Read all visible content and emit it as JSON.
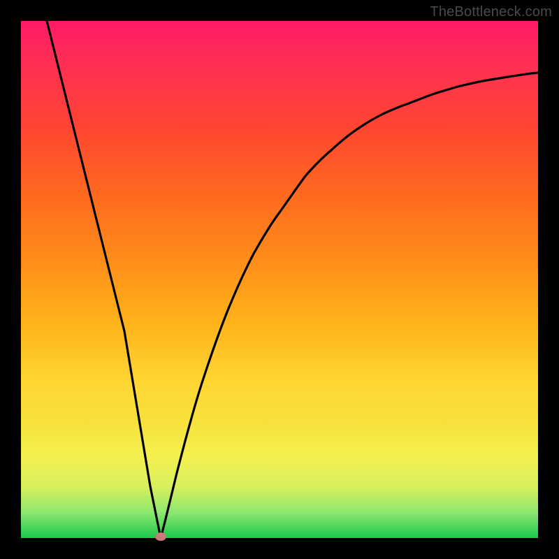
{
  "attribution": "TheBottleneck.com",
  "chart_data": {
    "type": "line",
    "title": "",
    "xlabel": "",
    "ylabel": "",
    "xlim": [
      0,
      100
    ],
    "ylim": [
      0,
      100
    ],
    "grid": false,
    "series": [
      {
        "name": "bottleneck-curve",
        "x": [
          5,
          10,
          15,
          20,
          25,
          27,
          30,
          35,
          40,
          45,
          50,
          55,
          60,
          65,
          70,
          75,
          80,
          85,
          90,
          95,
          100
        ],
        "y": [
          100,
          80,
          60,
          40,
          10,
          0,
          12,
          30,
          44,
          55,
          63,
          70,
          75,
          79,
          82,
          84,
          86,
          87.5,
          88.5,
          89.3,
          90
        ]
      }
    ],
    "annotations": [
      {
        "name": "minimum-marker",
        "x": 27,
        "y": 0
      }
    ],
    "background_gradient_stops": [
      {
        "pos": 0,
        "color": "#ff1a66"
      },
      {
        "pos": 20,
        "color": "#ff4433"
      },
      {
        "pos": 46,
        "color": "#ff8c1a"
      },
      {
        "pos": 70,
        "color": "#ffd633"
      },
      {
        "pos": 84,
        "color": "#f4f04e"
      },
      {
        "pos": 100,
        "color": "#1cc94e"
      }
    ]
  }
}
